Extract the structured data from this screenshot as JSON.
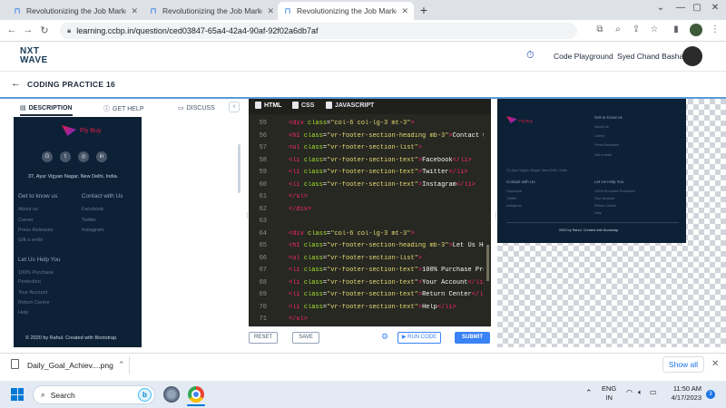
{
  "browser": {
    "tabs": [
      {
        "title": "Revolutionizing the Job Market |",
        "active": false
      },
      {
        "title": "Revolutionizing the Job Market |",
        "active": false
      },
      {
        "title": "Revolutionizing the Job Market |",
        "active": true
      }
    ],
    "new_tab": "+",
    "url": "learning.ccbp.in/question/ced03847-65a4-42a4-90af-92f02a6db7af"
  },
  "site": {
    "logo_line1": "NXT",
    "logo_line2": "WAVE",
    "code_playground": "Code Playground",
    "user_name": "Syed Chand Basha"
  },
  "practice": {
    "title": "CODING PRACTICE 16"
  },
  "left_tabs": [
    {
      "label": "DESCRIPTION",
      "icon": "book-icon"
    },
    {
      "label": "GET HELP",
      "icon": "help-icon"
    },
    {
      "label": "DISCUSS",
      "icon": "chat-icon"
    }
  ],
  "flybuy": {
    "brand": "Fly Buy",
    "social": [
      "G",
      "t",
      "◎",
      "in"
    ],
    "address": "37, Ayur Vigyan Nagar, New Delhi, India.",
    "col1_heading": "Get to know us",
    "col1_items": [
      "About us",
      "Career",
      "Press Releases",
      "Gift a smile"
    ],
    "col2_heading": "Contact with Us",
    "col2_items": [
      "Facebook",
      "Twitter",
      "Instagram"
    ],
    "help_heading": "Let Us Help You",
    "help_items": [
      "100% Purchase",
      "Protection",
      "Your Account",
      "Return Centre",
      "Help"
    ],
    "copyright": "© 2020 by Rahul. Created with Bootstrap."
  },
  "editor": {
    "tabs": [
      "HTML",
      "CSS",
      "JAVASCRIPT"
    ],
    "lines": [
      {
        "n": "55",
        "indent": "",
        "parts": [
          [
            "tg",
            "<div "
          ],
          [
            "at",
            "class"
          ],
          [
            "pn",
            "="
          ],
          [
            "st",
            "\"col-6 col-lg-3 mt-3\""
          ],
          [
            "tg",
            ">"
          ]
        ]
      },
      {
        "n": "56",
        "indent": "",
        "parts": [
          [
            "tg",
            "<h1 "
          ],
          [
            "at",
            "class"
          ],
          [
            "pn",
            "="
          ],
          [
            "st",
            "\"vr-footer-section-heading mb-3\""
          ],
          [
            "tg",
            ">"
          ],
          [
            "pn",
            "Contact w"
          ]
        ]
      },
      {
        "n": "57",
        "indent": "",
        "parts": [
          [
            "tg",
            "<ul "
          ],
          [
            "at",
            "class"
          ],
          [
            "pn",
            "="
          ],
          [
            "st",
            "\"vr-footer-section-list\""
          ],
          [
            "tg",
            ">"
          ]
        ]
      },
      {
        "n": "58",
        "indent": "",
        "parts": [
          [
            "tg",
            "<li "
          ],
          [
            "at",
            "class"
          ],
          [
            "pn",
            "="
          ],
          [
            "st",
            "\"vr-footer-section-text\""
          ],
          [
            "tg",
            ">"
          ],
          [
            "pn",
            "Facebook"
          ],
          [
            "tg",
            "</li>"
          ]
        ]
      },
      {
        "n": "59",
        "indent": "",
        "parts": [
          [
            "tg",
            "<li "
          ],
          [
            "at",
            "class"
          ],
          [
            "pn",
            "="
          ],
          [
            "st",
            "\"vr-footer-section-text\""
          ],
          [
            "tg",
            ">"
          ],
          [
            "pn",
            "Twitter"
          ],
          [
            "tg",
            "</li>"
          ]
        ]
      },
      {
        "n": "60",
        "indent": "",
        "parts": [
          [
            "tg",
            "<li "
          ],
          [
            "at",
            "class"
          ],
          [
            "pn",
            "="
          ],
          [
            "st",
            "\"vr-footer-section-text\""
          ],
          [
            "tg",
            ">"
          ],
          [
            "pn",
            "Instagram"
          ],
          [
            "tg",
            "</li>"
          ]
        ]
      },
      {
        "n": "61",
        "indent": "",
        "parts": [
          [
            "tg",
            "</ul>"
          ]
        ]
      },
      {
        "n": "62",
        "indent": "",
        "parts": [
          [
            "tg",
            "</div>"
          ]
        ]
      },
      {
        "n": "63",
        "indent": "",
        "parts": []
      },
      {
        "n": "64",
        "indent": "",
        "parts": [
          [
            "tg",
            "<div "
          ],
          [
            "at",
            "class"
          ],
          [
            "pn",
            "="
          ],
          [
            "st",
            "\"col-6 col-lg-3 mt-3\""
          ],
          [
            "tg",
            ">"
          ]
        ]
      },
      {
        "n": "65",
        "indent": "",
        "parts": [
          [
            "tg",
            "<h1 "
          ],
          [
            "at",
            "class"
          ],
          [
            "pn",
            "="
          ],
          [
            "st",
            "\"vr-footer-section-heading mb-3\""
          ],
          [
            "tg",
            ">"
          ],
          [
            "pn",
            "Let Us He"
          ]
        ]
      },
      {
        "n": "66",
        "indent": "",
        "parts": [
          [
            "tg",
            "<ul "
          ],
          [
            "at",
            "class"
          ],
          [
            "pn",
            "="
          ],
          [
            "st",
            "\"vr-footer-section-list\""
          ],
          [
            "tg",
            ">"
          ]
        ]
      },
      {
        "n": "67",
        "indent": "",
        "parts": [
          [
            "tg",
            "<li "
          ],
          [
            "at",
            "class"
          ],
          [
            "pn",
            "="
          ],
          [
            "st",
            "\"vr-footer-section-text\""
          ],
          [
            "tg",
            ">"
          ],
          [
            "pn",
            "100% Purchase Pro"
          ]
        ]
      },
      {
        "n": "68",
        "indent": "",
        "parts": [
          [
            "tg",
            "<li "
          ],
          [
            "at",
            "class"
          ],
          [
            "pn",
            "="
          ],
          [
            "st",
            "\"vr-footer-section-text\""
          ],
          [
            "tg",
            ">"
          ],
          [
            "pn",
            "Your Account"
          ],
          [
            "tg",
            "</li>"
          ]
        ]
      },
      {
        "n": "69",
        "indent": "",
        "parts": [
          [
            "tg",
            "<li "
          ],
          [
            "at",
            "class"
          ],
          [
            "pn",
            "="
          ],
          [
            "st",
            "\"vr-footer-section-text\""
          ],
          [
            "tg",
            ">"
          ],
          [
            "pn",
            "Return Center"
          ],
          [
            "tg",
            "</li"
          ]
        ]
      },
      {
        "n": "70",
        "indent": "",
        "parts": [
          [
            "tg",
            "<li "
          ],
          [
            "at",
            "class"
          ],
          [
            "pn",
            "="
          ],
          [
            "st",
            "\"vr-footer-section-text\""
          ],
          [
            "tg",
            ">"
          ],
          [
            "pn",
            "Help"
          ],
          [
            "tg",
            "</li>"
          ]
        ]
      },
      {
        "n": "71",
        "indent": "",
        "parts": [
          [
            "tg",
            "</ul>"
          ]
        ]
      }
    ],
    "buttons": {
      "reset": "RESET",
      "save": "SAVE",
      "run": "▶ RUN CODE",
      "submit": "SUBMIT"
    }
  },
  "preview": {
    "brand": "Fly Buy",
    "col1_heading": "Get to Know us",
    "col1_items": [
      "About Us",
      "Career",
      "Press Releases",
      "Get a smile"
    ],
    "address": "37,Ayur Vigyan Nagar, New Delhi, India",
    "contact_heading": "Contact with Us",
    "contact_items": [
      "Facebook",
      "Twitter",
      "Instagram"
    ],
    "help_heading": "Let Us Help You",
    "help_items": [
      "100% Purchase Protection",
      "Your Account",
      "Return Centre",
      "Help"
    ],
    "copyright": "2020 by Rahul. Created with Bootstrap."
  },
  "downloads": {
    "file": "Daily_Goal_Achiev....png",
    "show_all": "Show all"
  },
  "taskbar": {
    "search": "Search",
    "lang1": "ENG",
    "lang2": "IN",
    "time": "11:50 AM",
    "date": "4/17/2023",
    "notifications": "3"
  },
  "colors": {
    "accent": "#1a73e8",
    "footer_bg": "#0c2136",
    "editor_bg": "#272822",
    "submit": "#3b82f6"
  }
}
